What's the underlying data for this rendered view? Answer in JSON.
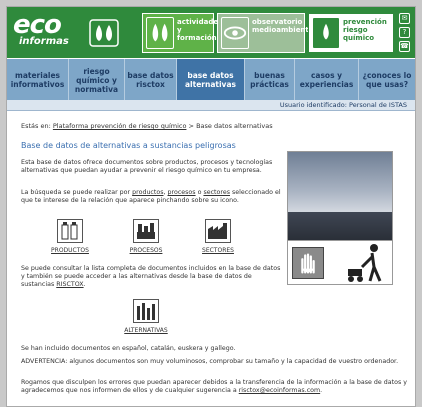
{
  "header": {
    "logo_top": "eco",
    "logo_bottom": "informas",
    "tabs": [
      {
        "label": "actividades y formación"
      },
      {
        "label": "observatorio medioambiental"
      },
      {
        "label": "prevención riesgo químico"
      }
    ],
    "side_icons": [
      "mail-icon",
      "question-icon",
      "phone-icon"
    ]
  },
  "nav": {
    "items": [
      {
        "label": "materiales informativos"
      },
      {
        "label": "riesgo químico y normativa"
      },
      {
        "label": "base datos risctox"
      },
      {
        "label": "base datos alternativas"
      },
      {
        "label": "buenas prácticas"
      },
      {
        "label": "casos y experiencias"
      },
      {
        "label": "¿conoces lo que usas?"
      }
    ]
  },
  "user_bar": "Usuario identificado: Personal de ISTAS",
  "breadcrumb": {
    "prefix": "Estás en:",
    "link": "Plataforma prevención de riesgo químico",
    "sep": ">",
    "current": "Base datos alternativas"
  },
  "title": "Base de datos de alternativas a sustancias peligrosas",
  "p1": "Esta base de datos ofrece documentos sobre productos, procesos y tecnologías alternativas que puedan ayudar a prevenir el riesgo químico en tu empresa.",
  "p2": {
    "a": "La búsqueda se puede realizar por",
    "productos": "productos",
    "procesos": "procesos",
    "sectores": "sectores",
    "b": "seleccionado el que te interese de la relación que aparece pinchando sobre su icono."
  },
  "icons": {
    "productos": "PRODUCTOS",
    "procesos": "PROCESOS",
    "sectores": "SECTORES",
    "alternativas": "ALTERNATIVAS"
  },
  "p3": {
    "a": "Se puede consultar la lista completa de documentos incluidos en la base de datos y también se puede acceder a las alternativas desde la base de datos de sustancias",
    "link": "RISCTOX"
  },
  "p4": "Se han incluido documentos en español, catalán, euskera y gallego.",
  "p5": "ADVERTENCIA: algunos documentos son muy voluminosos, comprobar su tamaño y la capacidad de vuestro ordenador.",
  "p6": {
    "a": "Rogamos que disculpen los errores que puedan aparecer debidos a la transferencia de la información a la base de datos y agradecemos que nos informen de ellos y de cualquier sugerencia a",
    "email": "risctox@ecoinformas.com"
  },
  "colors": {
    "header_green": "#2f8a3c",
    "nav_blue": "#7ea6c8",
    "nav_active": "#3f73a6",
    "title_blue": "#3a6fb0"
  }
}
